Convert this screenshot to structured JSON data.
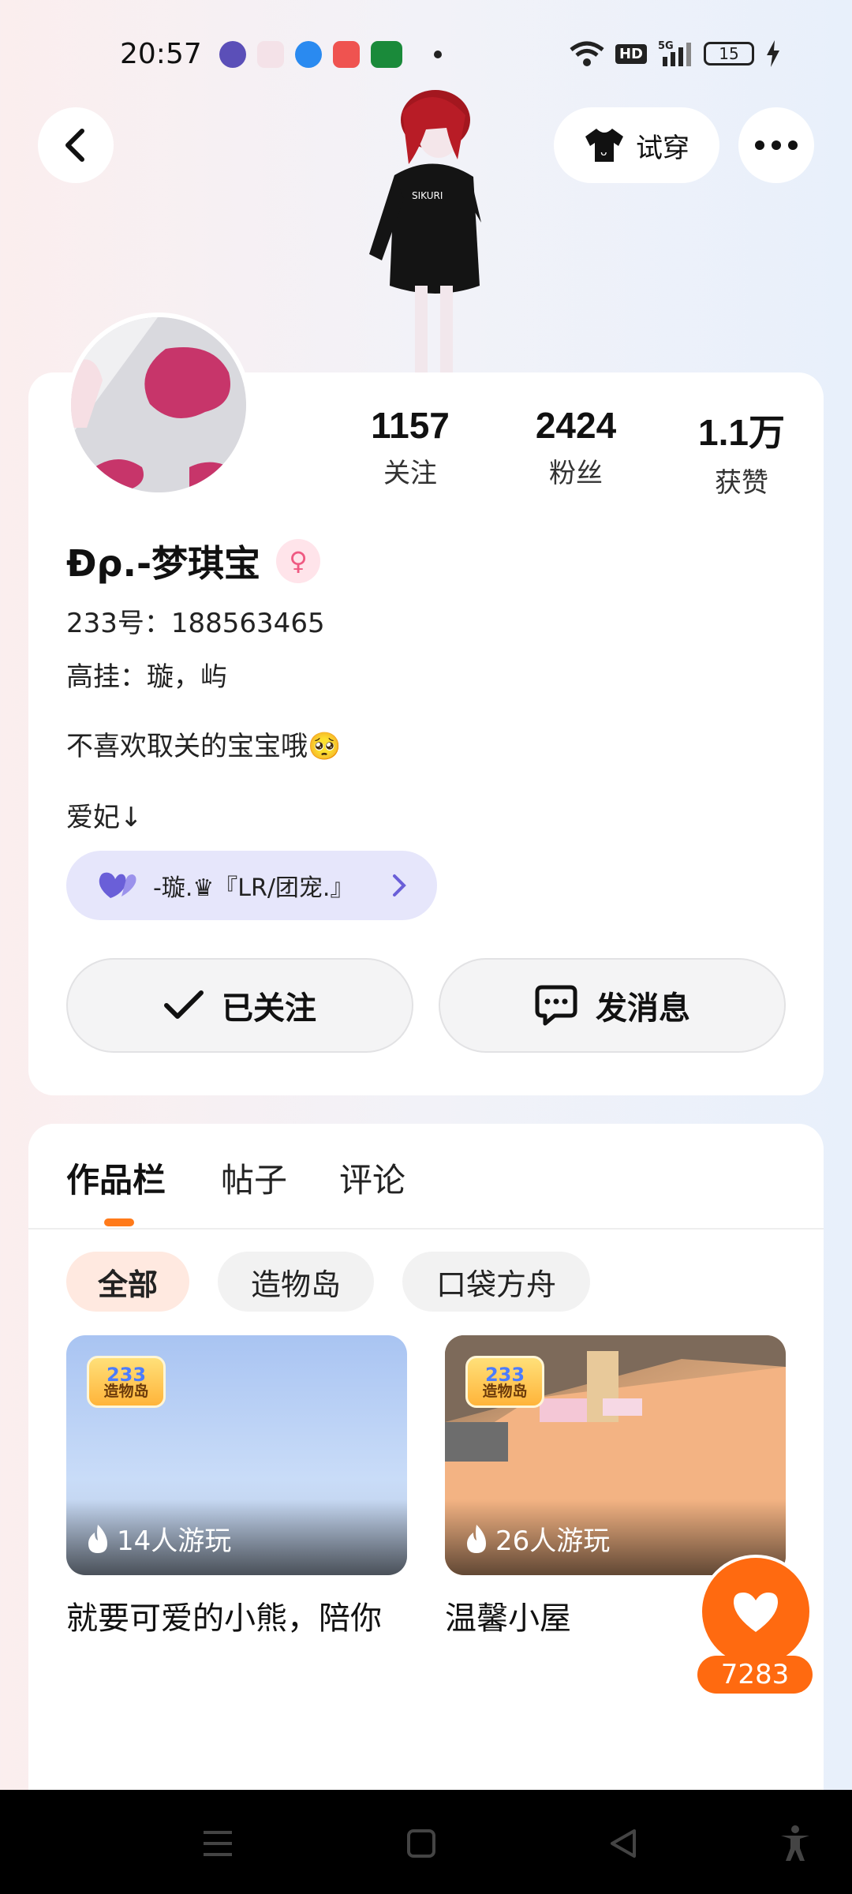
{
  "status_bar": {
    "time": "20:57",
    "battery": "15"
  },
  "header": {
    "tryon_label": "试穿"
  },
  "stats": [
    {
      "value": "1157",
      "label": "关注"
    },
    {
      "value": "2424",
      "label": "粉丝"
    },
    {
      "value": "1.1万",
      "label": "获赞"
    }
  ],
  "profile": {
    "nickname": "Ɖρ.-梦琪宝",
    "id_line": "233号：188563465",
    "hang_line": "高挂：璇，屿",
    "bio": "不喜欢取关的宝宝哦🥺",
    "love_line": "爱妃↓",
    "fan_tag": "-璇.♛『LR/团宠.』"
  },
  "actions": {
    "follow_label": "已关注",
    "message_label": "发消息"
  },
  "tabs": [
    "作品栏",
    "帖子",
    "评论"
  ],
  "filters": [
    "全部",
    "造物岛",
    "口袋方舟"
  ],
  "works": [
    {
      "plays": "14人游玩",
      "title": "就要可爱的小熊，陪你",
      "badge_number": "233",
      "badge_text": "造物岛"
    },
    {
      "plays": "26人游玩",
      "title": "温馨小屋",
      "badge_number": "233",
      "badge_text": "造物岛"
    }
  ],
  "like_float": {
    "count": "7283"
  },
  "colors": {
    "accent": "#ff6a10",
    "tab_indicator": "#ff7a1a",
    "fan_tag_bg": "#e6e6fb"
  }
}
